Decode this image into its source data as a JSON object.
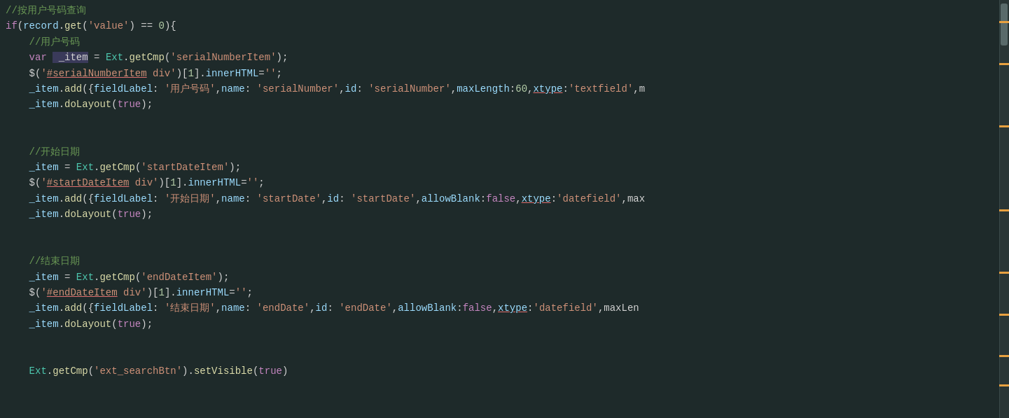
{
  "editor": {
    "background": "#1e2a2a",
    "lines": [
      {
        "id": 1,
        "content": "comment_query",
        "text": "//按用户号码查询"
      },
      {
        "id": 2,
        "content": "if_condition",
        "text": "if(record.get('value') == 0){"
      },
      {
        "id": 3,
        "content": "comment_user",
        "text": "    //用户号码"
      },
      {
        "id": 4,
        "content": "var_item",
        "text": "    var _item = Ext.getCmp('serialNumberItem');"
      },
      {
        "id": 5,
        "content": "jquery_serial",
        "text": "    $('#serialNumberItem div')[1].innerHTML='';"
      },
      {
        "id": 6,
        "content": "item_add_serial",
        "text": "    _item.add({fieldLabel: '用户号码',name: 'serialNumber',id: 'serialNumber',maxLength:60,xtype:'textfield',m"
      },
      {
        "id": 7,
        "content": "item_dolayout1",
        "text": "    _item.doLayout(true);"
      },
      {
        "id": 8,
        "content": "empty1",
        "text": ""
      },
      {
        "id": 9,
        "content": "empty2",
        "text": ""
      },
      {
        "id": 10,
        "content": "comment_start",
        "text": "    //开始日期"
      },
      {
        "id": 11,
        "content": "item_start",
        "text": "    _item = Ext.getCmp('startDateItem');"
      },
      {
        "id": 12,
        "content": "jquery_start",
        "text": "    $('#startDateItem div')[1].innerHTML='';"
      },
      {
        "id": 13,
        "content": "item_add_start",
        "text": "    _item.add({fieldLabel: '开始日期',name: 'startDate',id: 'startDate',allowBlank:false,xtype:'datefield',max"
      },
      {
        "id": 14,
        "content": "item_dolayout2",
        "text": "    _item.doLayout(true);"
      },
      {
        "id": 15,
        "content": "empty3",
        "text": ""
      },
      {
        "id": 16,
        "content": "empty4",
        "text": ""
      },
      {
        "id": 17,
        "content": "comment_end",
        "text": "    //结束日期"
      },
      {
        "id": 18,
        "content": "item_end",
        "text": "    _item = Ext.getCmp('endDateItem');"
      },
      {
        "id": 19,
        "content": "jquery_end",
        "text": "    $('#endDateItem div')[1].innerHTML='';"
      },
      {
        "id": 20,
        "content": "item_add_end",
        "text": "    _item.add({fieldLabel: '结束日期',name: 'endDate',id: 'endDate',allowBlank:false,xtype:'datefield',maxLen"
      },
      {
        "id": 21,
        "content": "item_dolayout3",
        "text": "    _item.doLayout(true);"
      },
      {
        "id": 22,
        "content": "empty5",
        "text": ""
      },
      {
        "id": 23,
        "content": "empty6",
        "text": ""
      },
      {
        "id": 24,
        "content": "ext_search",
        "text": "    Ext.getCmp('ext_searchBtn').setVisible(true)"
      }
    ]
  },
  "scrollbar": {
    "markers": [
      20,
      35,
      55,
      70,
      85
    ]
  }
}
